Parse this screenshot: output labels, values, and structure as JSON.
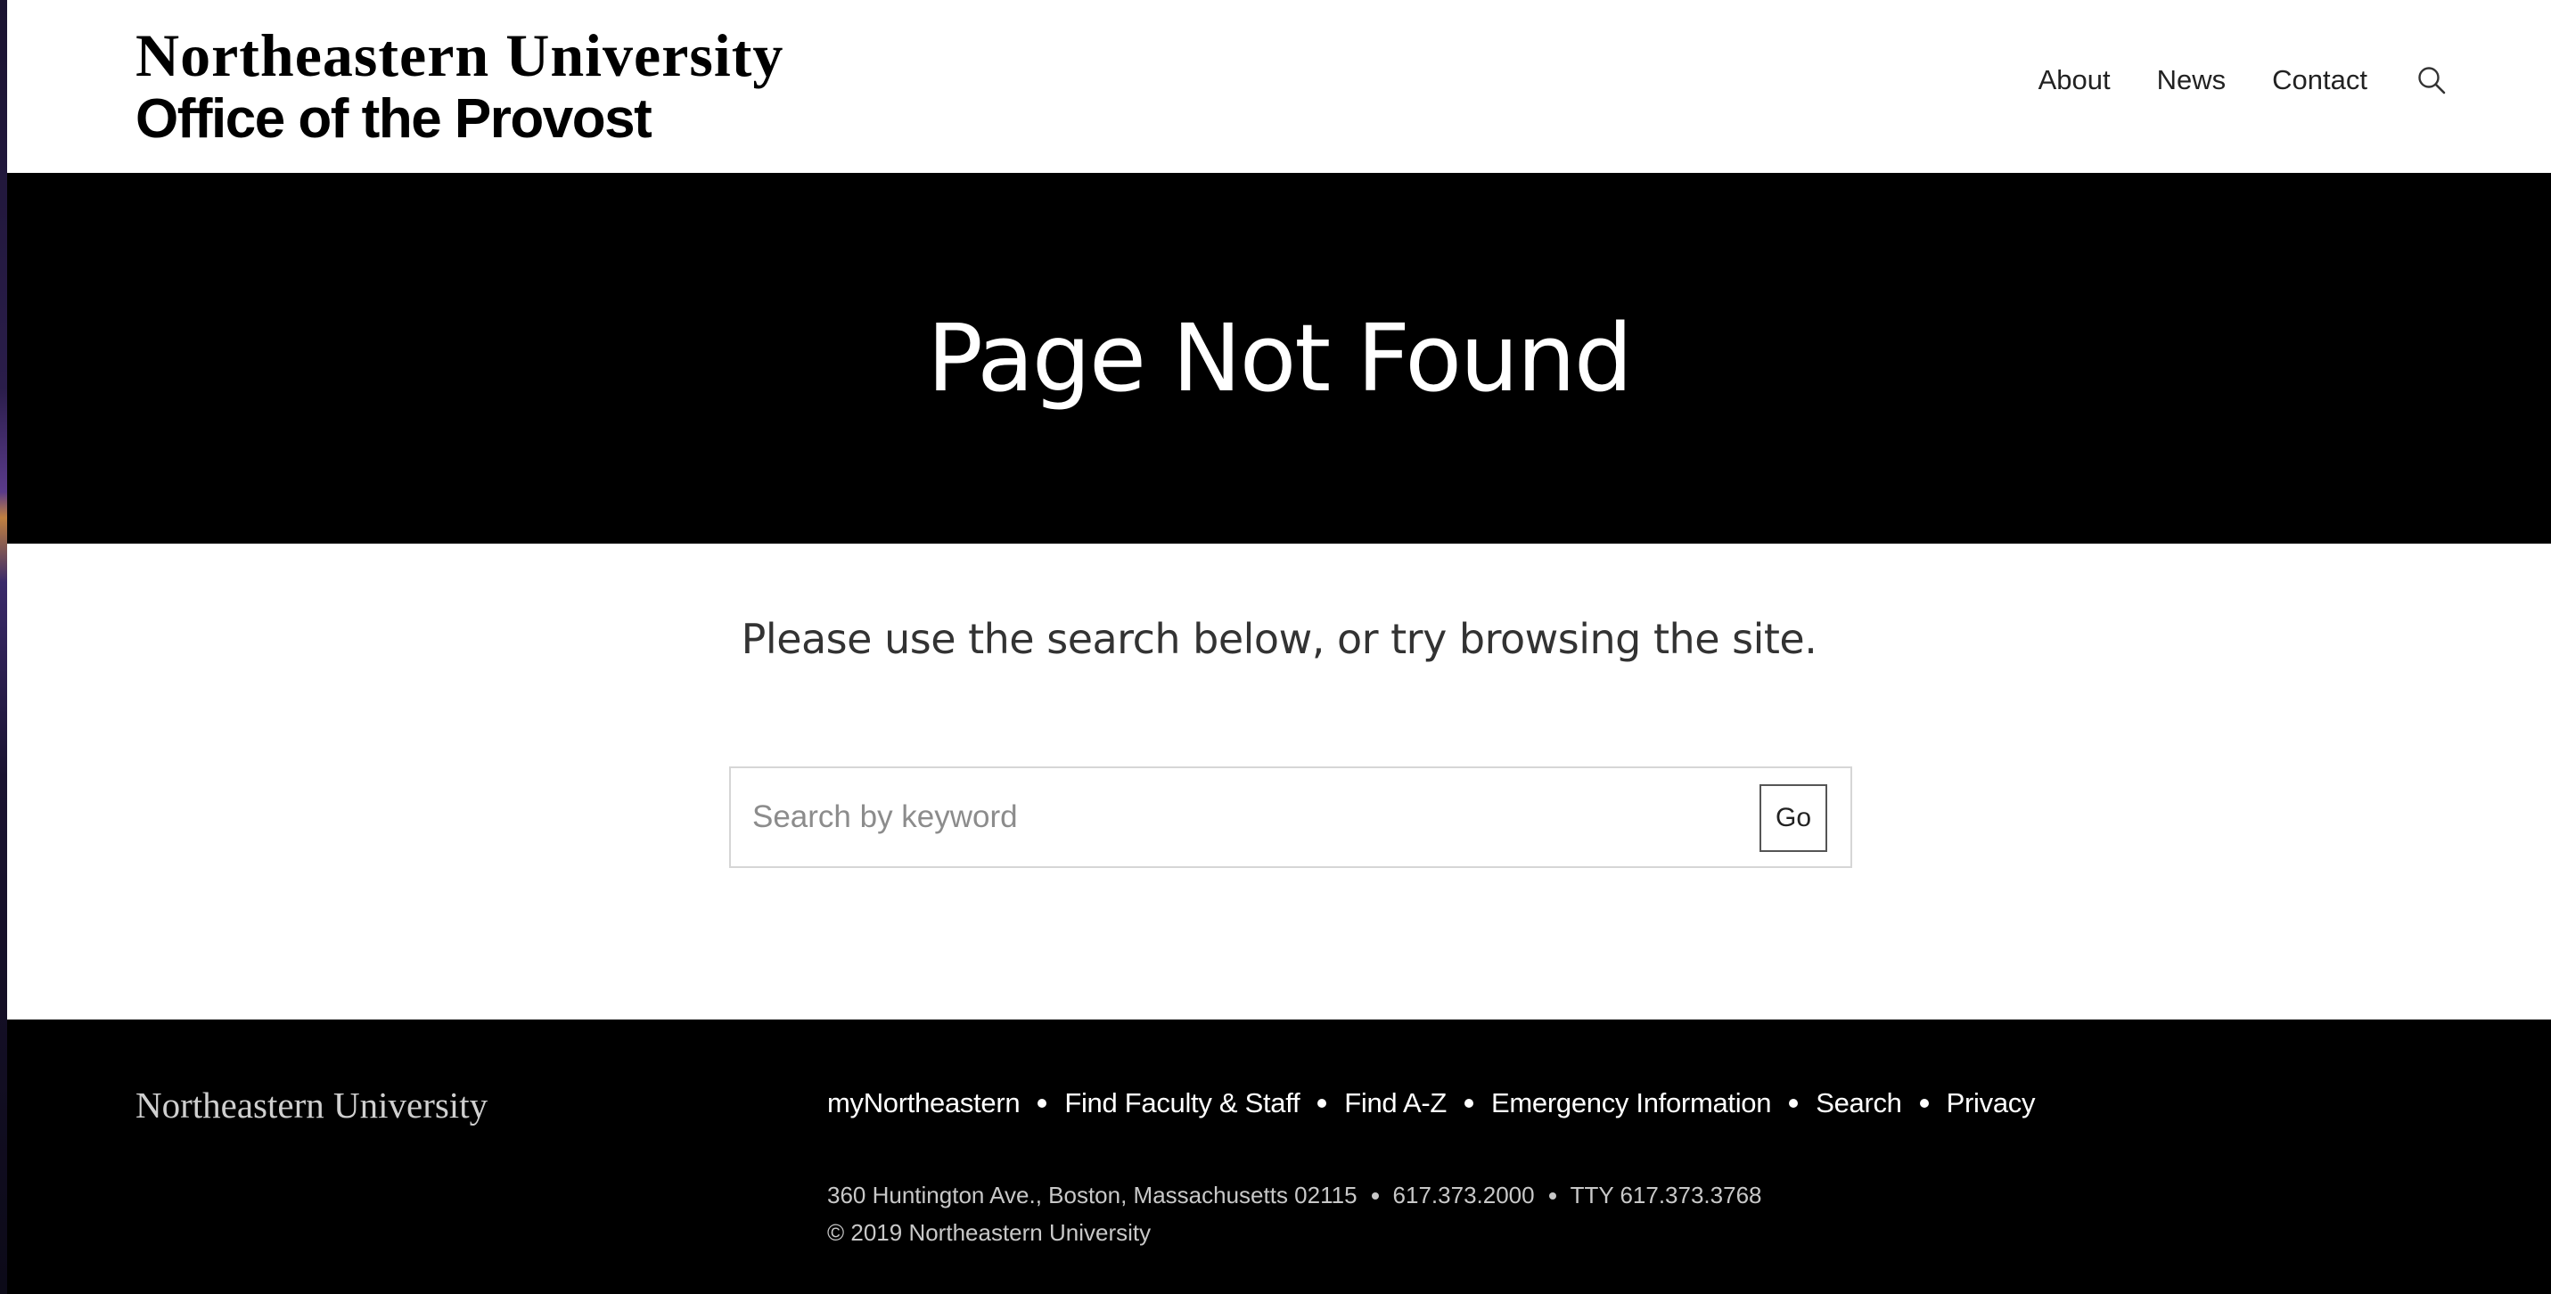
{
  "header": {
    "logo_line1": "Northeastern University",
    "logo_line2": "Office of the Provost",
    "nav": [
      {
        "label": "About"
      },
      {
        "label": "News"
      },
      {
        "label": "Contact"
      }
    ],
    "search_icon": "search-icon"
  },
  "hero": {
    "title": "Page Not Found"
  },
  "content": {
    "message": "Please use the search below, or try browsing the site.",
    "search": {
      "placeholder": "Search by keyword",
      "value": "",
      "button_label": "Go"
    }
  },
  "footer": {
    "logo": "Northeastern University",
    "links": [
      {
        "label": "myNortheastern"
      },
      {
        "label": "Find Faculty & Staff"
      },
      {
        "label": "Find A-Z"
      },
      {
        "label": "Emergency Information"
      },
      {
        "label": "Search"
      },
      {
        "label": "Privacy"
      }
    ],
    "address": "360 Huntington Ave., Boston, Massachusetts 02115",
    "phone": "617.373.2000",
    "tty": "TTY 617.373.3768",
    "copyright": "© 2019 Northeastern University"
  },
  "colors": {
    "hero_bg": "#000000",
    "footer_bg": "#000000",
    "text": "#222222"
  }
}
